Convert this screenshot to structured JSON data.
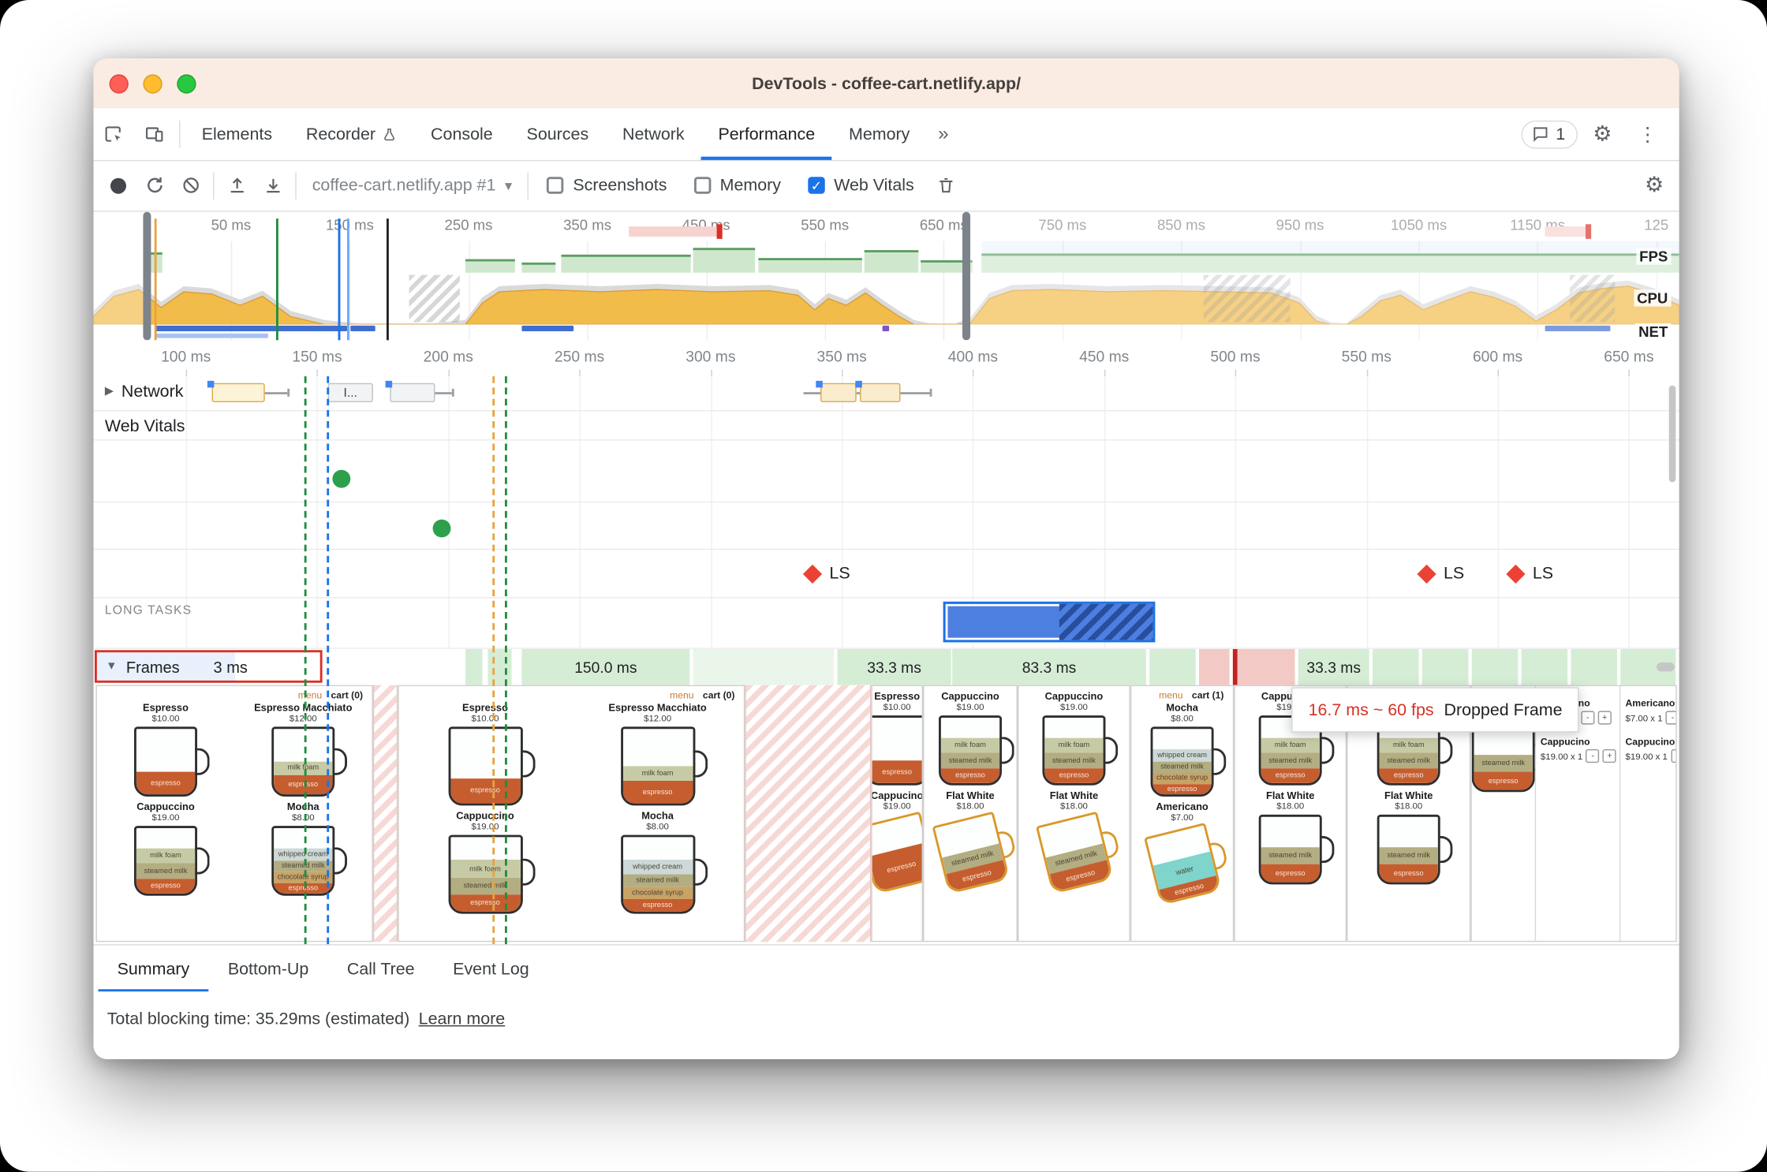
{
  "window": {
    "title": "DevTools - coffee-cart.netlify.app/"
  },
  "icons": {
    "gear": "⚙",
    "overflow_menu": "⋮",
    "caret_down": "▾",
    "disclosure_collapsed": "▶",
    "disclosure_expanded": "▼",
    "checkmark": "✓"
  },
  "tabbar": {
    "tabs": [
      {
        "label": "Elements",
        "active": false
      },
      {
        "label": "Recorder",
        "active": false,
        "icon": "flask-icon"
      },
      {
        "label": "Console",
        "active": false
      },
      {
        "label": "Sources",
        "active": false
      },
      {
        "label": "Network",
        "active": false
      },
      {
        "label": "Performance",
        "active": true
      },
      {
        "label": "Memory",
        "active": false
      }
    ],
    "more": "»",
    "issues_badge": "1"
  },
  "toolbar": {
    "profile_select": "coffee-cart.netlify.app #1",
    "checkboxes": [
      {
        "label": "Screenshots",
        "checked": false
      },
      {
        "label": "Memory",
        "checked": false
      },
      {
        "label": "Web Vitals",
        "checked": true
      }
    ]
  },
  "overview": {
    "ticks": [
      "50 ms",
      "150 ms",
      "250 ms",
      "350 ms",
      "450 ms",
      "550 ms",
      "650 ms",
      "750 ms",
      "850 ms",
      "950 ms",
      "1050 ms",
      "1150 ms",
      "125"
    ],
    "lane_labels": [
      "FPS",
      "CPU",
      "NET"
    ]
  },
  "timeline_ruler": {
    "ticks": [
      "100 ms",
      "150 ms",
      "200 ms",
      "250 ms",
      "300 ms",
      "350 ms",
      "400 ms",
      "450 ms",
      "500 ms",
      "550 ms",
      "600 ms",
      "650 ms"
    ]
  },
  "network_track": {
    "label": "Network",
    "truncated_label": "I..."
  },
  "web_vitals_track": {
    "label": "Web Vitals",
    "marker_label": "LS"
  },
  "long_tasks_track": {
    "label": "LONG TASKS"
  },
  "frames_track": {
    "label": "Frames",
    "selected_duration": "3 ms",
    "durations": [
      "150.0 ms",
      "33.3 ms",
      "83.3 ms",
      "33.3 ms"
    ],
    "tooltip": {
      "duration": "16.7 ms ~ 60 fps",
      "text": "Dropped Frame"
    }
  },
  "bottom_tab_bar": {
    "tabs": [
      {
        "label": "Summary",
        "active": true
      },
      {
        "label": "Bottom-Up",
        "active": false
      },
      {
        "label": "Call Tree",
        "active": false
      },
      {
        "label": "Event Log",
        "active": false
      }
    ]
  },
  "status_bar": {
    "text": "Total blocking time: 35.29ms (estimated)",
    "link": "Learn more"
  },
  "filmstrip": {
    "nav_menu": "menu",
    "nav_cart_empty": "cart (0)",
    "nav_cart_one": "cart (1)",
    "products": {
      "espresso": {
        "name": "Espresso",
        "price": "$10.00"
      },
      "espresso_macchiato": {
        "name": "Espresso Macchiato",
        "price": "$12.00"
      },
      "cappuccino": {
        "name": "Cappuccino",
        "price": "$19.00"
      },
      "mocha": {
        "name": "Mocha",
        "price": "$8.00"
      },
      "flat_white": {
        "name": "Flat White",
        "price": "$18.00"
      },
      "americano": {
        "name": "Americano",
        "price": "$7.00"
      },
      "cappucino": {
        "name": "Cappucino",
        "price": "$19.00"
      }
    },
    "layer_labels": {
      "milk_foam": "milk foam",
      "steamed_milk": "steamed milk",
      "espresso": "espresso",
      "whipped_cream": "whipped cream",
      "chocolate_syrup": "chocolate syrup",
      "water": "water"
    },
    "cart_items": [
      {
        "name": "Americano",
        "qty": "$7.00 x 1"
      },
      {
        "name": "Cappucino",
        "qty": "$19.00 x 1"
      }
    ],
    "stepper": {
      "minus": "-",
      "plus": "+"
    }
  },
  "colors": {
    "accent_blue": "#1a73e8",
    "inspect_red": "#d93025",
    "vitals_green": "#2da04c",
    "ls_red": "#ea4335",
    "frame_green": "#d6edd5",
    "frame_dropped_pink": "#f3c9c5"
  }
}
